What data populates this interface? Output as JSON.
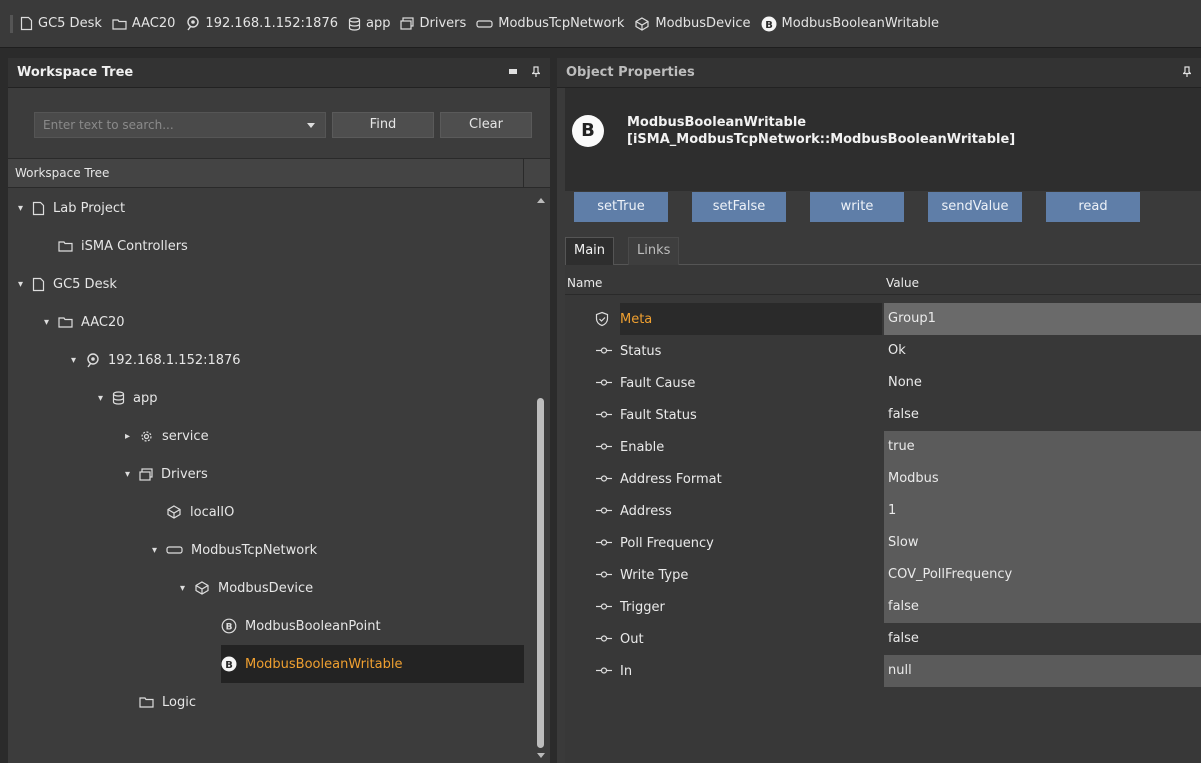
{
  "breadcrumb": [
    {
      "label": "GC5 Desk",
      "icon": "document-icon"
    },
    {
      "label": "AAC20",
      "icon": "folder-icon"
    },
    {
      "label": "192.168.1.152:1876",
      "icon": "station-icon"
    },
    {
      "label": "app",
      "icon": "database-icon"
    },
    {
      "label": "Drivers",
      "icon": "drivers-icon"
    },
    {
      "label": "ModbusTcpNetwork",
      "icon": "network-icon"
    },
    {
      "label": "ModbusDevice",
      "icon": "device-icon"
    },
    {
      "label": "ModbusBooleanWritable",
      "icon": "boolean-badge-icon"
    }
  ],
  "left_panel": {
    "title": "Workspace Tree",
    "search_placeholder": "Enter text to search...",
    "find_label": "Find",
    "clear_label": "Clear",
    "tree_header": "Workspace Tree",
    "nodes": [
      {
        "label": "Lab Project",
        "icon": "document-icon",
        "expanded": true
      },
      {
        "label": "iSMA Controllers",
        "icon": "folder-icon"
      },
      {
        "label": "GC5 Desk",
        "icon": "document-icon",
        "expanded": true
      },
      {
        "label": "AAC20",
        "icon": "folder-icon",
        "expanded": true
      },
      {
        "label": "192.168.1.152:1876",
        "icon": "station-icon",
        "expanded": true
      },
      {
        "label": "app",
        "icon": "database-icon",
        "expanded": true
      },
      {
        "label": "service",
        "icon": "gear-icon",
        "expanded": false
      },
      {
        "label": "Drivers",
        "icon": "drivers-icon",
        "expanded": true
      },
      {
        "label": "localIO",
        "icon": "device-icon"
      },
      {
        "label": "ModbusTcpNetwork",
        "icon": "network-icon",
        "expanded": true
      },
      {
        "label": "ModbusDevice",
        "icon": "device-icon",
        "expanded": true
      },
      {
        "label": "ModbusBooleanPoint",
        "icon": "boolean-point-icon"
      },
      {
        "label": "ModbusBooleanWritable",
        "icon": "boolean-badge-icon",
        "selected": true
      },
      {
        "label": "Logic",
        "icon": "folder-icon"
      }
    ]
  },
  "right_panel": {
    "title": "Object Properties",
    "object_badge": "B",
    "object_name": "ModbusBooleanWritable",
    "object_type": "[iSMA_ModbusTcpNetwork::ModbusBooleanWritable]",
    "actions": [
      "setTrue",
      "setFalse",
      "write",
      "sendValue",
      "read"
    ],
    "tabs": [
      "Main",
      "Links"
    ],
    "active_tab": "Main",
    "columns": {
      "name": "Name",
      "value": "Value"
    },
    "properties": [
      {
        "name": "Meta",
        "value": "Group1"
      },
      {
        "name": "Status",
        "value": "Ok"
      },
      {
        "name": "Fault Cause",
        "value": "None"
      },
      {
        "name": "Fault Status",
        "value": "false"
      },
      {
        "name": "Enable",
        "value": "true"
      },
      {
        "name": "Address Format",
        "value": "Modbus"
      },
      {
        "name": "Address",
        "value": "1"
      },
      {
        "name": "Poll Frequency",
        "value": "Slow"
      },
      {
        "name": "Write Type",
        "value": "COV_PollFrequency"
      },
      {
        "name": "Trigger",
        "value": "false"
      },
      {
        "name": "Out",
        "value": "false"
      },
      {
        "name": "In",
        "value": "null"
      }
    ]
  },
  "colors": {
    "accent_orange": "#f0a030",
    "action_blue": "#5f7ea8"
  }
}
